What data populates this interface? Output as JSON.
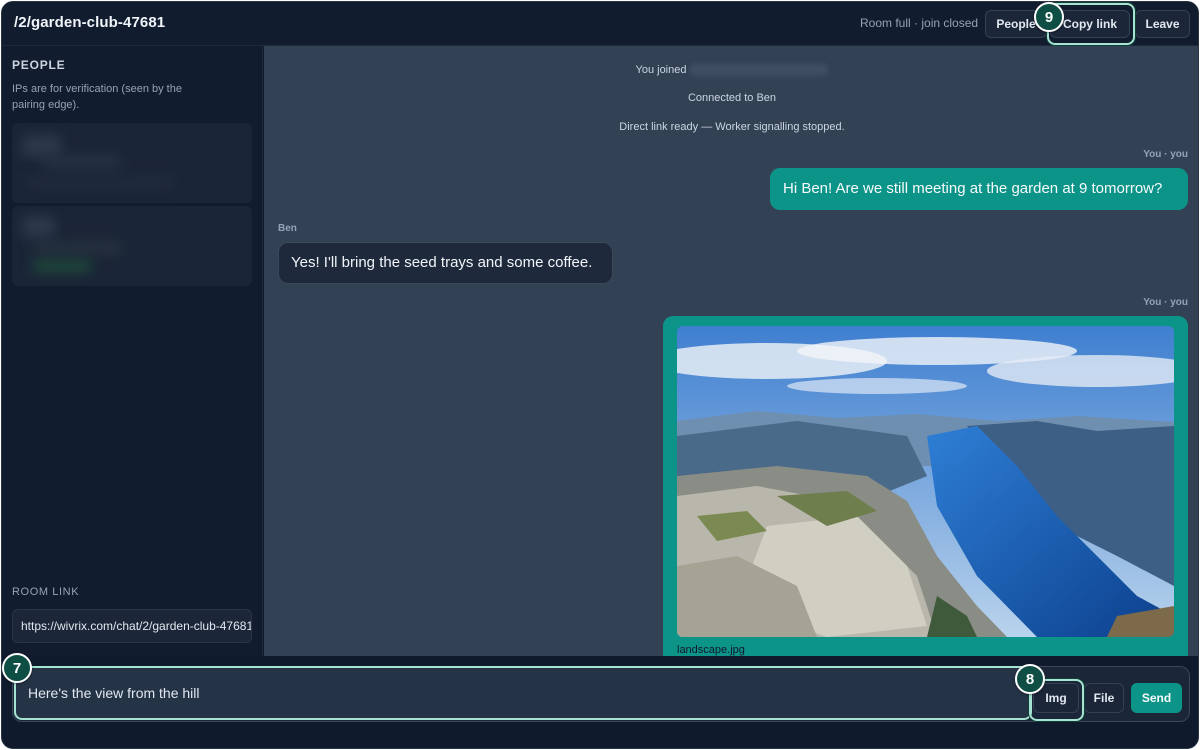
{
  "header": {
    "room_path": "/2/garden-club-47681",
    "status": "Room full · join closed",
    "people_label": "People",
    "copy_link_label": "Copy link",
    "leave_label": "Leave"
  },
  "sidebar": {
    "heading": "PEOPLE",
    "note": "IPs are for verification (seen by the pairing edge).",
    "room_link_label": "ROOM LINK",
    "room_link": "https://wivrix.com/chat/2/garden-club-47681"
  },
  "chat": {
    "system_messages": [
      "You joined",
      "Connected to Ben",
      "Direct link ready — Worker signalling stopped."
    ],
    "messages": [
      {
        "sender": "You · you",
        "text": "Hi Ben! Are we still meeting at the garden at 9 tomorrow?"
      },
      {
        "sender": "Ben",
        "text": "Yes! I'll bring the seed trays and some coffee."
      },
      {
        "sender": "You · you",
        "attachment": "landscape.jpg"
      }
    ]
  },
  "composer": {
    "input_value": "Here's the view from the hill",
    "img_label": "Img",
    "file_label": "File",
    "send_label": "Send"
  },
  "annotations": {
    "input_marker": "7",
    "img_marker": "8",
    "copy_marker": "9"
  },
  "colors": {
    "accent": "#0d9488",
    "highlight": "#a7e3d3",
    "marker": "#0e4e44"
  }
}
